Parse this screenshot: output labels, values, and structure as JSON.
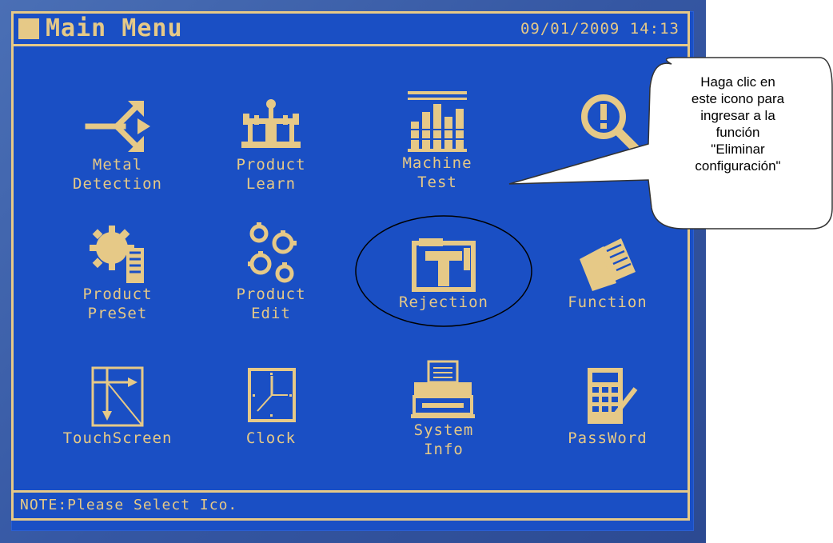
{
  "header": {
    "title": "Main Menu",
    "datetime": "09/01/2009  14:13"
  },
  "menu": {
    "items": [
      {
        "line1": "Metal",
        "line2": "Detection",
        "icon": "arrow-split-icon"
      },
      {
        "line1": "Product",
        "line2": "Learn",
        "icon": "scale-icon"
      },
      {
        "line1": "Machine",
        "line2": "Test",
        "icon": "bar-graph-icon"
      },
      {
        "line1": "",
        "line2": "",
        "icon": "magnifier-alert-icon"
      },
      {
        "line1": "Product",
        "line2": "PreSet",
        "icon": "preset-gear-icon"
      },
      {
        "line1": "Product",
        "line2": "Edit",
        "icon": "gears-icon"
      },
      {
        "line1": "Rejection",
        "line2": "",
        "icon": "toolbox-icon"
      },
      {
        "line1": "Function",
        "line2": "",
        "icon": "documents-icon"
      },
      {
        "line1": "TouchScreen",
        "line2": "",
        "icon": "touchscreen-calibrate-icon"
      },
      {
        "line1": "Clock",
        "line2": "",
        "icon": "clock-icon"
      },
      {
        "line1": "System",
        "line2": "Info",
        "icon": "printer-icon"
      },
      {
        "line1": "PassWord",
        "line2": "",
        "icon": "calculator-pen-icon"
      }
    ]
  },
  "note": {
    "text": "NOTE:Please Select Ico."
  },
  "callout": {
    "line1": "Haga clic en",
    "line2": "este icono para",
    "line3": "ingresar a la",
    "line4": "función",
    "line5": "\"Eliminar",
    "line6": "configuración\""
  },
  "colors": {
    "screen_bg": "#1a4fc4",
    "accent": "#e6c987",
    "bezel": "#3557a3"
  }
}
